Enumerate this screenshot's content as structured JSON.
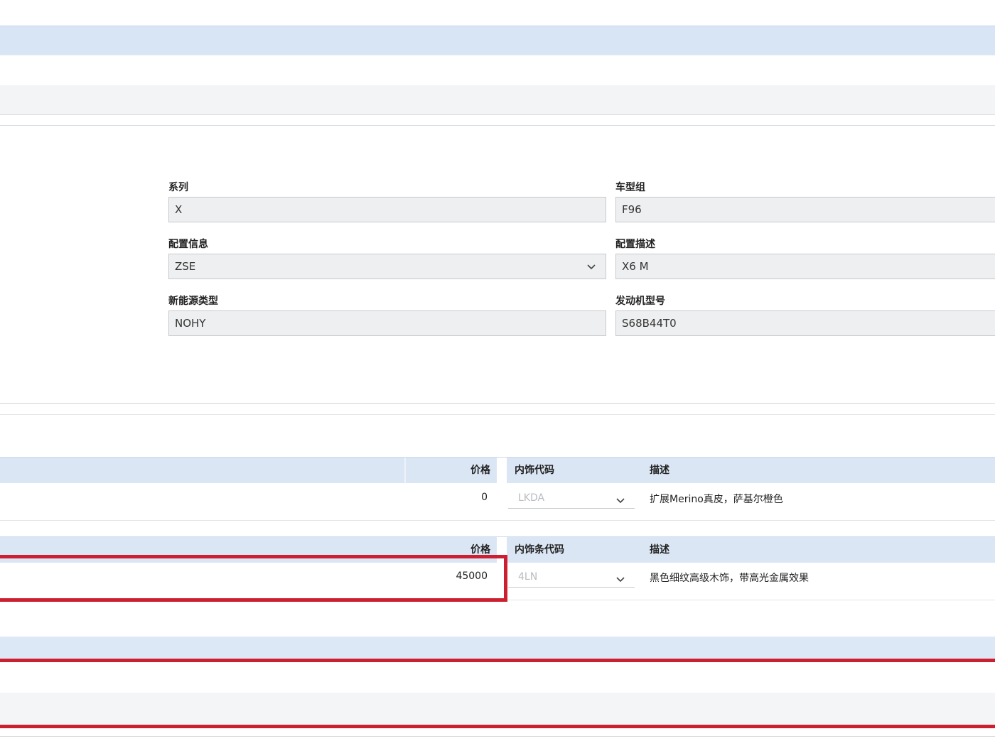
{
  "form": {
    "series": {
      "label": "系列",
      "value": "X"
    },
    "model_group": {
      "label": "车型组",
      "value": "F96"
    },
    "config_info": {
      "label": "配置信息",
      "value": "ZSE"
    },
    "config_desc": {
      "label": "配置描述",
      "value": "X6 M"
    },
    "new_energy_type": {
      "label": "新能源类型",
      "value": "NOHY"
    },
    "engine_model": {
      "label": "发动机型号",
      "value": "S68B44T0"
    }
  },
  "upholstery_table": {
    "headers": {
      "price": "价格",
      "code": "内饰代码",
      "desc": "描述"
    },
    "row": {
      "price": "0",
      "code": "LKDA",
      "desc": "扩展Merino真皮，萨基尔橙色"
    }
  },
  "trim_table": {
    "headers": {
      "price": "价格",
      "code": "内饰条代码",
      "desc": "描述"
    },
    "row": {
      "price": "45000",
      "code": "4LN",
      "desc": "黑色细纹高级木饰，带高光金属效果"
    }
  },
  "colors": {
    "highlight_red": "#cc1f2f",
    "header_blue": "#dbe6f5",
    "field_gray": "#eeeff0"
  },
  "icons": {
    "dropdown": "chevron-down-icon"
  }
}
